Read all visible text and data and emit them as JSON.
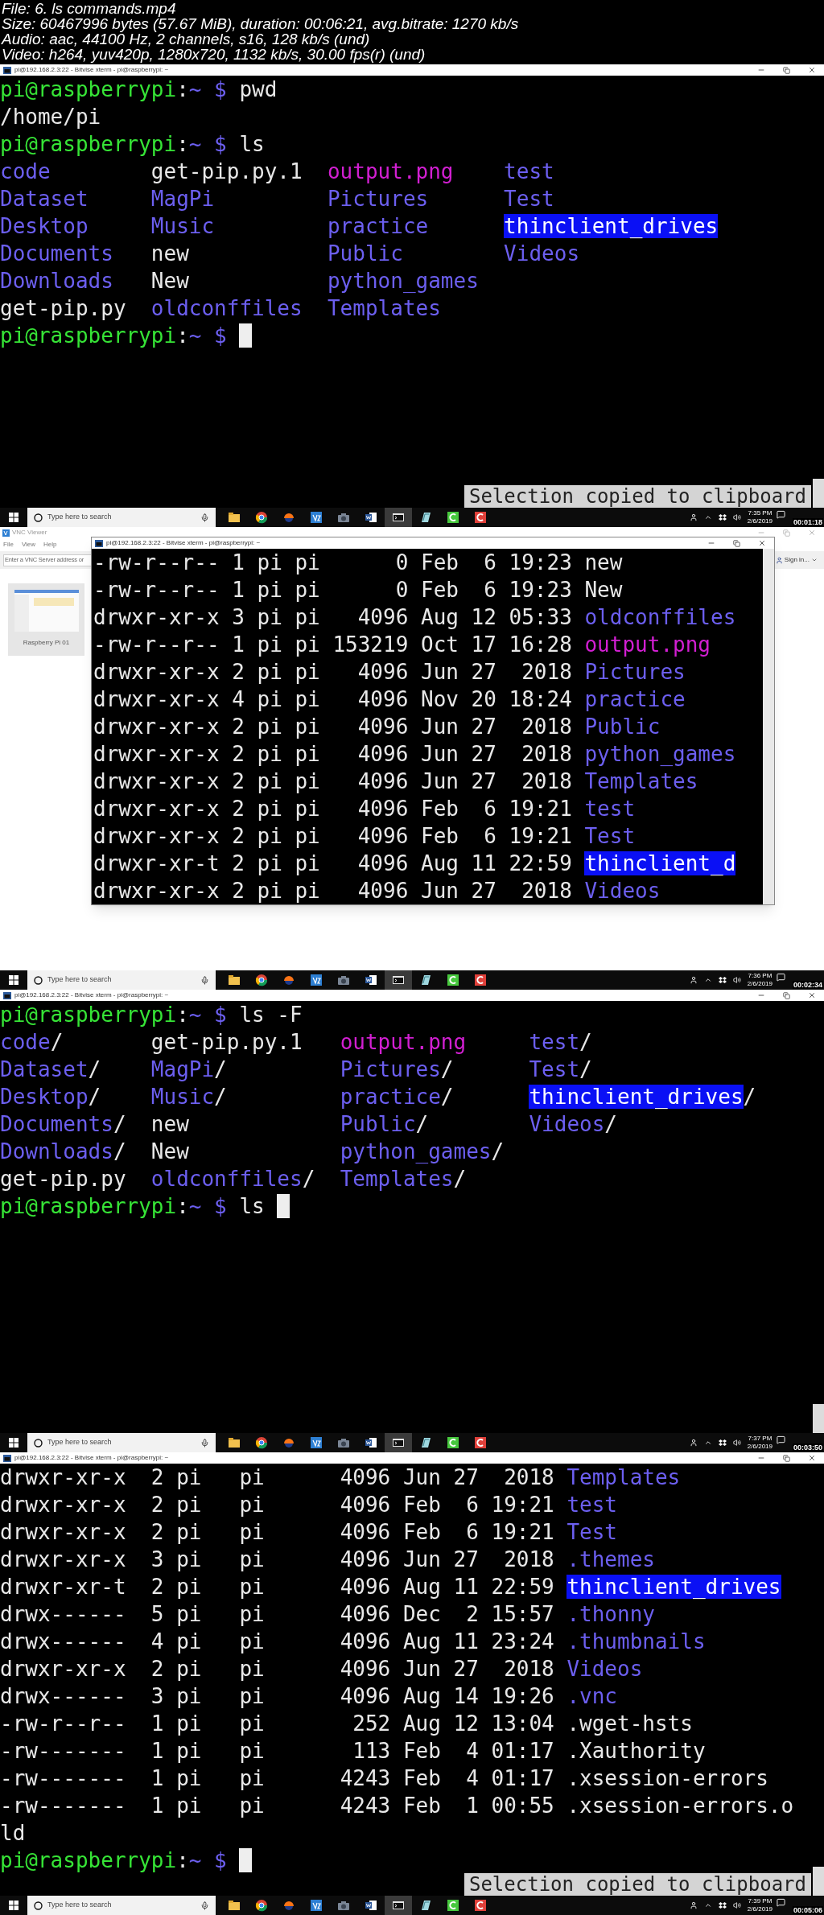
{
  "header": [
    "File: 6. ls commands.mp4",
    "Size: 60467996 bytes (57.67 MiB), duration: 00:06:21, avg.bitrate: 1270 kb/s",
    "Audio: aac, 44100 Hz, 2 channels, s16, 128 kb/s (und)",
    "Video: h264, yuv420p, 1280x720, 1132 kb/s, 30.00 fps(r) (und)"
  ],
  "frames": [
    {
      "kind": "terminal",
      "title": "pi@192.168.2.3:22 - Bitvise xterm - pi@raspberrypi: ~",
      "notice": "Selection copied to clipboard",
      "lines": [
        {
          "kind": "prompt",
          "user": "pi@raspberrypi",
          "colon": ":",
          "path": "~",
          "sign": "$",
          "command": "pwd",
          "cursor": false
        },
        {
          "kind": "output",
          "text": "/home/pi"
        },
        {
          "kind": "prompt",
          "user": "pi@raspberrypi",
          "colon": ":",
          "path": "~",
          "sign": "$",
          "command": "ls",
          "cursor": false
        },
        {
          "kind": "columns",
          "rows": [
            [
              {
                "name": "code",
                "kind": "dir"
              },
              {
                "name": "get-pip.py.1",
                "kind": "file"
              },
              {
                "name": "output.png",
                "kind": "image"
              },
              {
                "name": "test",
                "kind": "dir"
              }
            ],
            [
              {
                "name": "Dataset",
                "kind": "dir"
              },
              {
                "name": "MagPi",
                "kind": "dir"
              },
              {
                "name": "Pictures",
                "kind": "dir"
              },
              {
                "name": "Test",
                "kind": "dir"
              }
            ],
            [
              {
                "name": "Desktop",
                "kind": "dir"
              },
              {
                "name": "Music",
                "kind": "dir"
              },
              {
                "name": "practice",
                "kind": "dir"
              },
              {
                "name": "thinclient_drives",
                "kind": "marked-dir"
              }
            ],
            [
              {
                "name": "Documents",
                "kind": "dir"
              },
              {
                "name": "new",
                "kind": "file"
              },
              {
                "name": "Public",
                "kind": "dir"
              },
              {
                "name": "Videos",
                "kind": "dir"
              }
            ],
            [
              {
                "name": "Downloads",
                "kind": "dir"
              },
              {
                "name": "New",
                "kind": "file"
              },
              {
                "name": "python_games",
                "kind": "dir"
              }
            ],
            [
              {
                "name": "get-pip.py",
                "kind": "file"
              },
              {
                "name": "oldconffiles",
                "kind": "dir"
              },
              {
                "name": "Templates",
                "kind": "dir"
              }
            ]
          ]
        },
        {
          "kind": "prompt",
          "user": "pi@raspberrypi",
          "colon": ":",
          "path": "~",
          "sign": "$",
          "cursor": true
        }
      ],
      "taskbar": {
        "search_placeholder": "Type here to search",
        "time": "7:35 PM",
        "date": "2/6/2019",
        "timestamp": "00:01:18"
      }
    },
    {
      "kind": "vnc",
      "app_title": "VNC Viewer",
      "menu": [
        "File",
        "View",
        "Help"
      ],
      "address_placeholder": "Enter a VNC Server address or",
      "sign_in": "Sign in...",
      "computer": "Raspberry Pi 01",
      "window": {
        "title": "pi@192.168.2.3:22 - Bitvise xterm - pi@raspberrypi: ~",
        "lines": [
          {
            "kind": "long",
            "info": "-rw-r--r-- 1 pi pi      0 Feb  6 19:23",
            "file": {
              "name": "new",
              "kind": "file"
            }
          },
          {
            "kind": "long",
            "info": "-rw-r--r-- 1 pi pi      0 Feb  6 19:23",
            "file": {
              "name": "New",
              "kind": "file"
            }
          },
          {
            "kind": "long",
            "info": "drwxr-xr-x 3 pi pi   4096 Aug 12 05:33",
            "file": {
              "name": "oldconffiles",
              "kind": "dir"
            }
          },
          {
            "kind": "long",
            "info": "-rw-r--r-- 1 pi pi 153219 Oct 17 16:28",
            "file": {
              "name": "output.png",
              "kind": "image"
            }
          },
          {
            "kind": "long",
            "info": "drwxr-xr-x 2 pi pi   4096 Jun 27  2018",
            "file": {
              "name": "Pictures",
              "kind": "dir"
            }
          },
          {
            "kind": "long",
            "info": "drwxr-xr-x 4 pi pi   4096 Nov 20 18:24",
            "file": {
              "name": "practice",
              "kind": "dir"
            }
          },
          {
            "kind": "long",
            "info": "drwxr-xr-x 2 pi pi   4096 Jun 27  2018",
            "file": {
              "name": "Public",
              "kind": "dir"
            }
          },
          {
            "kind": "long",
            "info": "drwxr-xr-x 2 pi pi   4096 Jun 27  2018",
            "file": {
              "name": "python_games",
              "kind": "dir"
            }
          },
          {
            "kind": "long",
            "info": "drwxr-xr-x 2 pi pi   4096 Jun 27  2018",
            "file": {
              "name": "Templates",
              "kind": "dir"
            }
          },
          {
            "kind": "long",
            "info": "drwxr-xr-x 2 pi pi   4096 Feb  6 19:21",
            "file": {
              "name": "test",
              "kind": "dir"
            }
          },
          {
            "kind": "long",
            "info": "drwxr-xr-x 2 pi pi   4096 Feb  6 19:21",
            "file": {
              "name": "Test",
              "kind": "dir"
            }
          },
          {
            "kind": "long",
            "info": "drwxr-xr-t 2 pi pi   4096 Aug 11 22:59",
            "file": {
              "name": "thinclient_d",
              "kind": "marked-dir"
            }
          },
          {
            "kind": "long",
            "info": "drwxr-xr-x 2 pi pi   4096 Jun 27  2018",
            "file": {
              "name": "Videos",
              "kind": "dir"
            }
          }
        ]
      },
      "taskbar": {
        "search_placeholder": "Type here to search",
        "time": "7:36 PM",
        "date": "2/6/2019",
        "timestamp": "00:02:34"
      }
    },
    {
      "kind": "terminal",
      "title": "pi@192.168.2.3:22 - Bitvise xterm - pi@raspberrypi: ~",
      "lines": [
        {
          "kind": "prompt",
          "user": "pi@raspberrypi",
          "colon": ":",
          "path": "~",
          "sign": "$",
          "command": "ls -F",
          "cursor": false
        },
        {
          "kind": "columns",
          "rows": [
            [
              {
                "name": "code",
                "kind": "dir",
                "suffix": "/"
              },
              {
                "name": "get-pip.py.1",
                "kind": "file"
              },
              {
                "name": "output.png",
                "kind": "image"
              },
              {
                "name": "test",
                "kind": "dir",
                "suffix": "/"
              }
            ],
            [
              {
                "name": "Dataset",
                "kind": "dir",
                "suffix": "/"
              },
              {
                "name": "MagPi",
                "kind": "dir",
                "suffix": "/"
              },
              {
                "name": "Pictures",
                "kind": "dir",
                "suffix": "/"
              },
              {
                "name": "Test",
                "kind": "dir",
                "suffix": "/"
              }
            ],
            [
              {
                "name": "Desktop",
                "kind": "dir",
                "suffix": "/"
              },
              {
                "name": "Music",
                "kind": "dir",
                "suffix": "/"
              },
              {
                "name": "practice",
                "kind": "dir",
                "suffix": "/"
              },
              {
                "name": "thinclient_drives",
                "kind": "marked-dir",
                "suffix": "/"
              }
            ],
            [
              {
                "name": "Documents",
                "kind": "dir",
                "suffix": "/"
              },
              {
                "name": "new",
                "kind": "file"
              },
              {
                "name": "Public",
                "kind": "dir",
                "suffix": "/"
              },
              {
                "name": "Videos",
                "kind": "dir",
                "suffix": "/"
              }
            ],
            [
              {
                "name": "Downloads",
                "kind": "dir",
                "suffix": "/"
              },
              {
                "name": "New",
                "kind": "file"
              },
              {
                "name": "python_games",
                "kind": "dir",
                "suffix": "/"
              }
            ],
            [
              {
                "name": "get-pip.py",
                "kind": "file"
              },
              {
                "name": "oldconffiles",
                "kind": "dir",
                "suffix": "/"
              },
              {
                "name": "Templates",
                "kind": "dir",
                "suffix": "/"
              }
            ]
          ]
        },
        {
          "kind": "prompt",
          "user": "pi@raspberrypi",
          "colon": ":",
          "path": "~",
          "sign": "$",
          "command": "ls",
          "cursor": true
        }
      ],
      "taskbar": {
        "search_placeholder": "Type here to search",
        "time": "7:37 PM",
        "date": "2/6/2019",
        "timestamp": "00:03:50"
      }
    },
    {
      "kind": "terminal",
      "title": "pi@192.168.2.3:22 - Bitvise xterm - pi@raspberrypi: ~",
      "notice": "Selection copied to clipboard",
      "lines": [
        {
          "kind": "long",
          "info": "drwxr-xr-x  2 pi   pi      4096 Jun 27  2018",
          "file": {
            "name": "Templates",
            "kind": "dir"
          }
        },
        {
          "kind": "long",
          "info": "drwxr-xr-x  2 pi   pi      4096 Feb  6 19:21",
          "file": {
            "name": "test",
            "kind": "dir"
          }
        },
        {
          "kind": "long",
          "info": "drwxr-xr-x  2 pi   pi      4096 Feb  6 19:21",
          "file": {
            "name": "Test",
            "kind": "dir"
          }
        },
        {
          "kind": "long",
          "info": "drwxr-xr-x  3 pi   pi      4096 Jun 27  2018",
          "file": {
            "name": ".themes",
            "kind": "dir"
          }
        },
        {
          "kind": "long",
          "info": "drwxr-xr-t  2 pi   pi      4096 Aug 11 22:59",
          "file": {
            "name": "thinclient_drives",
            "kind": "marked-dir"
          }
        },
        {
          "kind": "long",
          "info": "drwx------  5 pi   pi      4096 Dec  2 15:57",
          "file": {
            "name": ".thonny",
            "kind": "dir"
          }
        },
        {
          "kind": "long",
          "info": "drwx------  4 pi   pi      4096 Aug 11 23:24",
          "file": {
            "name": ".thumbnails",
            "kind": "dir"
          }
        },
        {
          "kind": "long",
          "info": "drwxr-xr-x  2 pi   pi      4096 Jun 27  2018",
          "file": {
            "name": "Videos",
            "kind": "dir"
          }
        },
        {
          "kind": "long",
          "info": "drwx------  3 pi   pi      4096 Aug 14 19:26",
          "file": {
            "name": ".vnc",
            "kind": "dir"
          }
        },
        {
          "kind": "long",
          "info": "-rw-r--r--  1 pi   pi       252 Aug 12 13:04",
          "file": {
            "name": ".wget-hsts",
            "kind": "file"
          }
        },
        {
          "kind": "long",
          "info": "-rw-------  1 pi   pi       113 Feb  4 01:17",
          "file": {
            "name": ".Xauthority",
            "kind": "file"
          }
        },
        {
          "kind": "long",
          "info": "-rw-------  1 pi   pi      4243 Feb  4 01:17",
          "file": {
            "name": ".xsession-errors",
            "kind": "file"
          }
        },
        {
          "kind": "long",
          "info": "-rw-------  1 pi   pi      4243 Feb  1 00:55",
          "file": {
            "name": ".xsession-errors.o",
            "kind": "file"
          }
        },
        {
          "kind": "output",
          "text": "ld"
        },
        {
          "kind": "prompt",
          "user": "pi@raspberrypi",
          "colon": ":",
          "path": "~",
          "sign": "$",
          "cursor": true
        }
      ],
      "taskbar": {
        "search_placeholder": "Type here to search",
        "time": "7:39 PM",
        "date": "2/6/2019",
        "timestamp": "00:05:06"
      }
    }
  ]
}
